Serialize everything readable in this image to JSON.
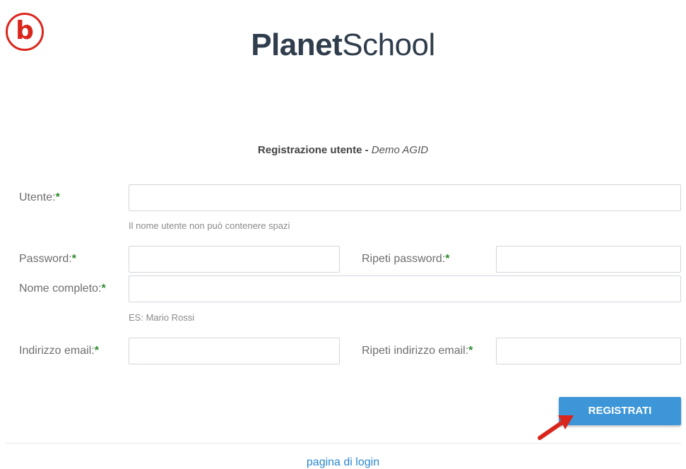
{
  "badge": {
    "letter": "b"
  },
  "logo": {
    "bold_part": "Planet",
    "light_part": "School"
  },
  "header": {
    "title": "Registrazione utente",
    "separator": " - ",
    "demo": "Demo AGID"
  },
  "form": {
    "required_mark": "*",
    "utente": {
      "label": "Utente:",
      "value": "",
      "help": "Il nome utente non può contenere spazi"
    },
    "password": {
      "label": "Password:",
      "value": ""
    },
    "ripeti_password": {
      "label": "Ripeti password:",
      "value": ""
    },
    "nome_completo": {
      "label": "Nome completo:",
      "value": "",
      "help": "ES: Mario Rossi"
    },
    "email": {
      "label": "Indirizzo email:",
      "value": ""
    },
    "ripeti_email": {
      "label": "Ripeti indirizzo email:",
      "value": ""
    }
  },
  "actions": {
    "register_label": "REGISTRATI"
  },
  "footer": {
    "login_link": "pagina di login"
  },
  "colors": {
    "accent": "#3d96d8",
    "logo": "#2f3d4c",
    "required": "#2c8a2c",
    "annotation": "#d9261c",
    "link": "#2a87cf"
  }
}
